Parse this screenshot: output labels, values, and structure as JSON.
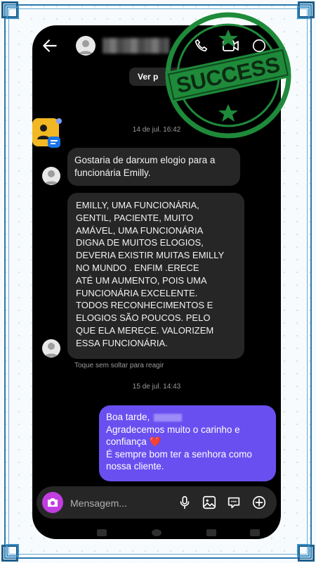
{
  "header": {
    "verp_label": "Ver p"
  },
  "conversation": {
    "date1": "14 de jul. 16:42",
    "msg1": "Gostaria de darxum elogio para a funcionária Emilly.",
    "msg2": "EMILLY,  UMA FUNCIONÁRIA,\nGENTIL, PACIENTE,  MUITO\nAMÁVEL,  UMA FUNCIONÁRIA\nDIGNA DE MUITOS ELOGIOS,\nDEVERIA EXISTIR MUITAS EMILLY\nNO MUNDO .  ENFIM .ERECE\nATÉ UM AUMENTO, POIS UMA\nFUNCIONÁRIA  EXCELENTE.\nTODOS RECONHECIMENTOS E\nELOGIOS SÃO POUCOS. PELO\nQUE ELA MERECE.   VALORIZEM\nESSA FUNCIONÁRIA.",
    "react_hint": "Toque sem soltar para reagir",
    "date2": "15 de jul. 14:43",
    "reply": {
      "line1": "Boa tarde,",
      "line2": "Agradecemos muito o carinho e",
      "line3": "confiança",
      "heart": "❤️",
      "line4": "É sempre bom ter a senhora como",
      "line5": "nossa cliente."
    }
  },
  "composer": {
    "placeholder": "Mensagem..."
  },
  "stamp": {
    "text": "SUCCESS"
  },
  "colors": {
    "outgoing_bubble": "#6a4ff0",
    "incoming_bubble": "#262626",
    "stamp_green": "#1e8a3a",
    "camera_button": "#c13ee0"
  },
  "icons": [
    "back-arrow-icon",
    "phone-icon",
    "video-icon",
    "more-icon",
    "camera-icon",
    "mic-icon",
    "image-icon",
    "sticker-icon",
    "add-icon"
  ]
}
